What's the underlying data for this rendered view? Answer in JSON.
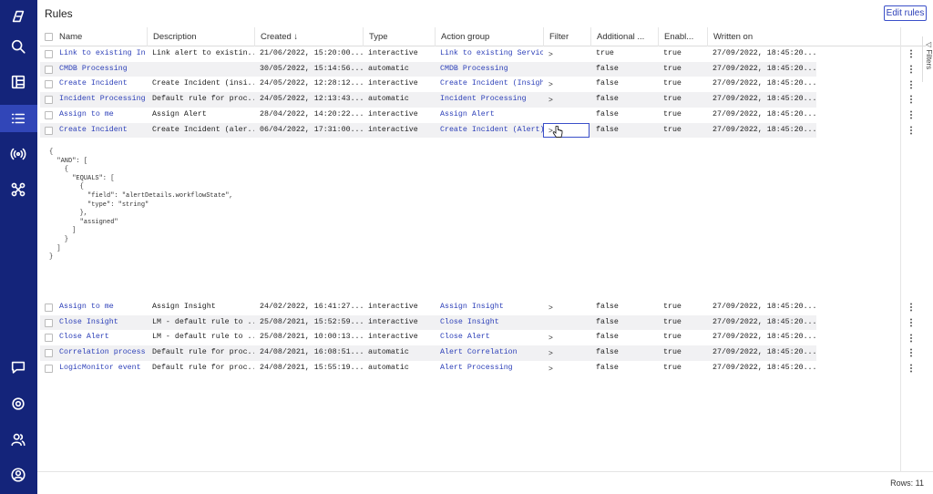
{
  "page": {
    "title": "Rules",
    "edit_button": "Edit rules",
    "rows_label": "Rows: 11",
    "filters_tab": "Filters"
  },
  "nav": {
    "items": [
      {
        "icon": "logo-icon"
      },
      {
        "icon": "search-icon"
      },
      {
        "icon": "dashboard-icon"
      },
      {
        "icon": "list-icon",
        "active": true
      },
      {
        "icon": "broadcast-icon"
      },
      {
        "icon": "integration-icon"
      },
      {
        "icon": "chat-icon"
      },
      {
        "icon": "settings-icon"
      },
      {
        "icon": "users-icon"
      },
      {
        "icon": "account-icon"
      }
    ]
  },
  "columns": {
    "name": "Name",
    "description": "Description",
    "created": "Created ↓",
    "type": "Type",
    "action_group": "Action group",
    "filter": "Filter",
    "additional": "Additional ...",
    "enabled": "Enabl...",
    "written_on": "Written on"
  },
  "rows": [
    {
      "name": "Link to existing In",
      "description": "Link alert to existin...",
      "created": "21/06/2022, 15:20:00....",
      "type": "interactive",
      "action_group": "Link to existing Service",
      "filter": ">",
      "additional": "true",
      "enabled": "true",
      "written_on": "27/09/2022,  18:45:20..."
    },
    {
      "name": "CMDB Processing",
      "description": "",
      "created": "30/05/2022, 15:14:56....",
      "type": "automatic",
      "action_group": "CMDB Processing",
      "filter": "",
      "additional": "false",
      "enabled": "true",
      "written_on": "27/09/2022,  18:45:20..."
    },
    {
      "name": "Create Incident",
      "description": "Create Incident (insi...",
      "created": "24/05/2022, 12:28:12....",
      "type": "interactive",
      "action_group": "Create Incident (Insight",
      "filter": ">",
      "additional": "false",
      "enabled": "true",
      "written_on": "27/09/2022,  18:45:20..."
    },
    {
      "name": "Incident Processing",
      "description": "Default rule for proc...",
      "created": "24/05/2022, 12:13:43....",
      "type": "automatic",
      "action_group": "Incident Processing",
      "filter": ">",
      "additional": "false",
      "enabled": "true",
      "written_on": "27/09/2022,  18:45:20..."
    },
    {
      "name": "Assign to me",
      "description": "Assign Alert",
      "created": "28/04/2022, 14:20:22....",
      "type": "interactive",
      "action_group": "Assign Alert",
      "filter": "",
      "additional": "false",
      "enabled": "true",
      "written_on": "27/09/2022,  18:45:20..."
    },
    {
      "name": "Create Incident",
      "description": "Create Incident (aler...",
      "created": "06/04/2022, 17:31:00....",
      "type": "interactive",
      "action_group": "Create Incident (Alert)",
      "filter": ">",
      "additional": "false",
      "enabled": "true",
      "written_on": "27/09/2022,  18:45:20..."
    },
    {
      "name": "Assign to me",
      "description": "Assign Insight",
      "created": "24/02/2022, 16:41:27....",
      "type": "interactive",
      "action_group": "Assign Insight",
      "filter": ">",
      "additional": "false",
      "enabled": "true",
      "written_on": "27/09/2022,  18:45:20..."
    },
    {
      "name": "Close Insight",
      "description": "LM - default rule to ...",
      "created": "25/08/2021, 15:52:59....",
      "type": "interactive",
      "action_group": "Close Insight",
      "filter": "",
      "additional": "false",
      "enabled": "true",
      "written_on": "27/09/2022,  18:45:20..."
    },
    {
      "name": "Close Alert",
      "description": "LM - default rule to ...",
      "created": "25/08/2021, 10:00:13....",
      "type": "interactive",
      "action_group": "Close Alert",
      "filter": ">",
      "additional": "false",
      "enabled": "true",
      "written_on": "27/09/2022,  18:45:20..."
    },
    {
      "name": "Correlation process",
      "description": "Default rule for proc...",
      "created": "24/08/2021, 16:08:51....",
      "type": "automatic",
      "action_group": "Alert Correlation",
      "filter": ">",
      "additional": "false",
      "enabled": "true",
      "written_on": "27/09/2022,  18:45:20..."
    },
    {
      "name": "LogicMonitor event",
      "description": "Default rule for proc...",
      "created": "24/08/2021, 15:55:19....",
      "type": "automatic",
      "action_group": "Alert Processing",
      "filter": ">",
      "additional": "false",
      "enabled": "true",
      "written_on": "27/09/2022,  18:45:20..."
    }
  ],
  "expanded_filter": "{\n  \"AND\": [\n    {\n      \"EQUALS\": [\n        {\n          \"field\": \"alertDetails.workflowState\",\n          \"type\": \"string\"\n        },\n        \"assigned\"\n      ]\n    }\n  ]\n}"
}
